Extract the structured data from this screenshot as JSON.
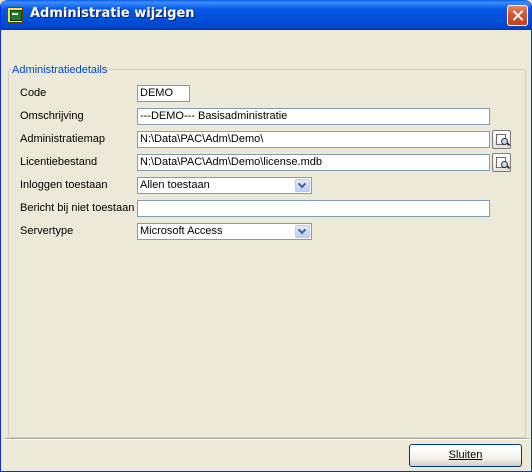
{
  "window": {
    "title": "Administratie wijzigen"
  },
  "group": {
    "legend": "Administratiedetails"
  },
  "fields": {
    "code": {
      "label": "Code",
      "value": "DEMO"
    },
    "omschrijving": {
      "label": "Omschrijving",
      "value": "---DEMO--- Basisadministratie"
    },
    "administratiemap": {
      "label": "Administratiemap",
      "value": "N:\\Data\\PAC\\Adm\\Demo\\"
    },
    "licentiebestand": {
      "label": "Licentiebestand",
      "value": "N:\\Data\\PAC\\Adm\\Demo\\license.mdb"
    },
    "inloggen": {
      "label": "Inloggen toestaan",
      "value": "Allen toestaan"
    },
    "bericht": {
      "label": "Bericht bij niet toestaan",
      "value": ""
    },
    "servertype": {
      "label": "Servertype",
      "value": "Microsoft Access"
    }
  },
  "buttons": {
    "close_label": "Sluiten"
  },
  "icons": {
    "app": "app-icon",
    "close": "close-icon",
    "browse": "folder-search-icon",
    "dropdown": "chevron-down-icon"
  }
}
